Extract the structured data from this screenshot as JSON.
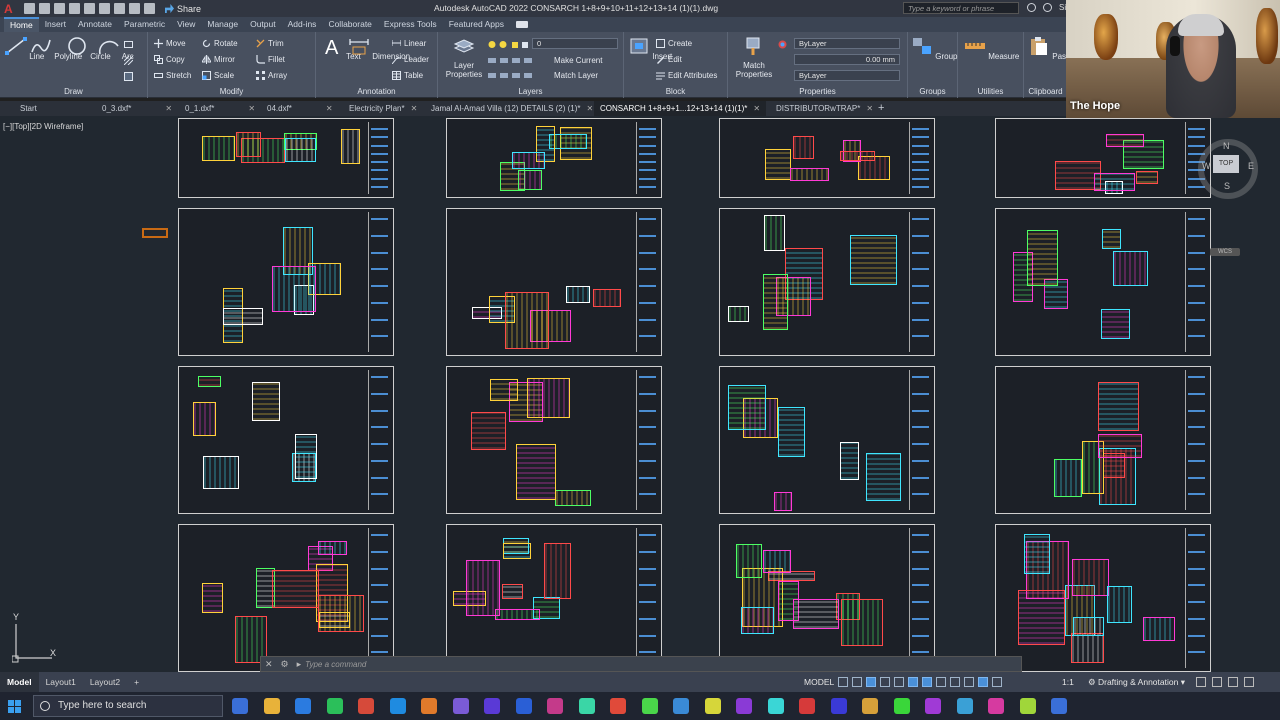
{
  "app": {
    "title": "Autodesk AutoCAD 2022   CONSARCH 1+8+9+10+11+12+13+14 (1)(1).dwg",
    "share_label": "Share",
    "search_placeholder": "Type a keyword or phrase",
    "signin_label": "Sign"
  },
  "ribbon_tabs": [
    "Home",
    "Insert",
    "Annotate",
    "Parametric",
    "View",
    "Manage",
    "Output",
    "Add-ins",
    "Collaborate",
    "Express Tools",
    "Featured Apps"
  ],
  "ribbon": {
    "draw": {
      "label": "Draw",
      "line": "Line",
      "polyline": "Polyline",
      "circle": "Circle",
      "arc": "Arc"
    },
    "modify": {
      "label": "Modify",
      "move": "Move",
      "rotate": "Rotate",
      "trim": "Trim",
      "copy": "Copy",
      "mirror": "Mirror",
      "fillet": "Fillet",
      "stretch": "Stretch",
      "scale": "Scale",
      "array": "Array"
    },
    "annotation": {
      "label": "Annotation",
      "text": "Text",
      "dimension": "Dimension",
      "linear": "Linear",
      "leader": "Leader",
      "table": "Table"
    },
    "layers": {
      "label": "Layers",
      "layer_properties": "Layer Properties",
      "current_layer": "0",
      "make_current": "Make Current",
      "match_layer": "Match Layer"
    },
    "block": {
      "label": "Block",
      "insert": "Insert",
      "create": "Create",
      "edit": "Edit",
      "edit_attributes": "Edit Attributes"
    },
    "properties": {
      "label": "Properties",
      "match_properties": "Match Properties",
      "color": "ByLayer",
      "lineweight": "0.00 mm",
      "linetype": "ByLayer"
    },
    "groups": {
      "label": "Groups",
      "group": "Group"
    },
    "utilities": {
      "label": "Utilities",
      "measure": "Measure"
    },
    "clipboard": {
      "label": "Clipboard",
      "paste": "Paste"
    }
  },
  "doc_tabs": [
    {
      "label": "Start",
      "closable": false
    },
    {
      "label": "0_3.dxf*",
      "closable": true
    },
    {
      "label": "0_1.dxf*",
      "closable": true
    },
    {
      "label": "04.dxf*",
      "closable": true
    },
    {
      "label": "Electricity Plan*",
      "closable": true
    },
    {
      "label": "Jamal Al-Amad Villa (12) DETAILS (2) (1)*",
      "closable": true
    },
    {
      "label": "CONSARCH 1+8+9+1...12+13+14 (1)(1)*",
      "closable": true
    },
    {
      "label": "DISTRIBUTORwTRAP*",
      "closable": true
    }
  ],
  "viewport_label": "[−][Top][2D Wireframe]",
  "viewcube": {
    "top": "TOP",
    "north": "N",
    "south": "S",
    "west": "W",
    "east": "E",
    "wcs": "WCS"
  },
  "ucs": {
    "y": "Y",
    "x": "X"
  },
  "command": {
    "placeholder": "Type a command"
  },
  "layout_tabs": [
    "Model",
    "Layout1",
    "Layout2"
  ],
  "status": {
    "model": "MODEL",
    "scale": "1:1",
    "workspace": "Drafting & Annotation"
  },
  "taskbar": {
    "search_placeholder": "Type here to search"
  },
  "webcam": {
    "label": "The Hope"
  },
  "colors": {
    "accent": "#4a90d9",
    "canvas": "#212830",
    "ribbon": "#48505f"
  }
}
